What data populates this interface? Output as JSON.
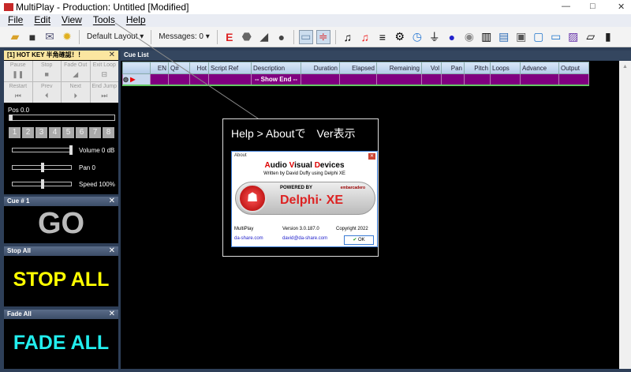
{
  "window": {
    "title": "MultiPlay - Production: Untitled [Modified]",
    "minimize": "—",
    "maximize": "□",
    "close": "✕"
  },
  "menu": [
    "File",
    "Edit",
    "View",
    "Tools",
    "Help"
  ],
  "toolbar": {
    "layout": "Default Layout ▾",
    "messages": "Messages: 0 ▾"
  },
  "hotkey_panel": {
    "title": "[1] HOT KEY 半角確認！！",
    "buttons": [
      "Pause",
      "Stop",
      "Fade Out",
      "Exit Loop",
      "Restart",
      "Prev",
      "Next",
      "End Jump"
    ],
    "pos": "Pos 0.0",
    "numbers": [
      "1",
      "2",
      "3",
      "4",
      "5",
      "6",
      "7",
      "8"
    ],
    "volume": "Volume 0 dB",
    "pan": "Pan 0",
    "speed": "Speed 100%",
    "volume_level": 1.0,
    "pan_level": 0.5,
    "speed_level": 0.5
  },
  "cue_panel": {
    "title": "Cue # 1",
    "label": "GO"
  },
  "stop_panel": {
    "title": "Stop All",
    "label": "STOP ALL"
  },
  "fade_panel": {
    "title": "Fade All",
    "label": "FADE ALL"
  },
  "cue_list": {
    "title": "Cue List",
    "columns": [
      "",
      "EN",
      "Q#",
      "Hot",
      "Script Ref",
      "Description",
      "Duration",
      "Elapsed",
      "Remaining",
      "Vol",
      "Pan",
      "Pitch",
      "Loops",
      "Advance",
      "Output"
    ],
    "row": {
      "description": "-- Show End --"
    }
  },
  "annotation": {
    "text": "Help > Aboutで　Ver表示"
  },
  "about": {
    "title": "About",
    "heading_a": "A",
    "heading_1": "udio ",
    "heading_v": "V",
    "heading_2": "isual ",
    "heading_d": "D",
    "heading_3": "evices",
    "written": "Written by David Duffy using Delphi XE",
    "powered": "POWERED BY",
    "embarcadero": "embarcadero",
    "delphi": "Delphi· XE",
    "app": "MultiPlay",
    "version": "Version 3.0.187.0",
    "copyright": "Copyright 2022",
    "site": "da-share.com",
    "email": "david@da-share.com",
    "ok": "OK"
  }
}
